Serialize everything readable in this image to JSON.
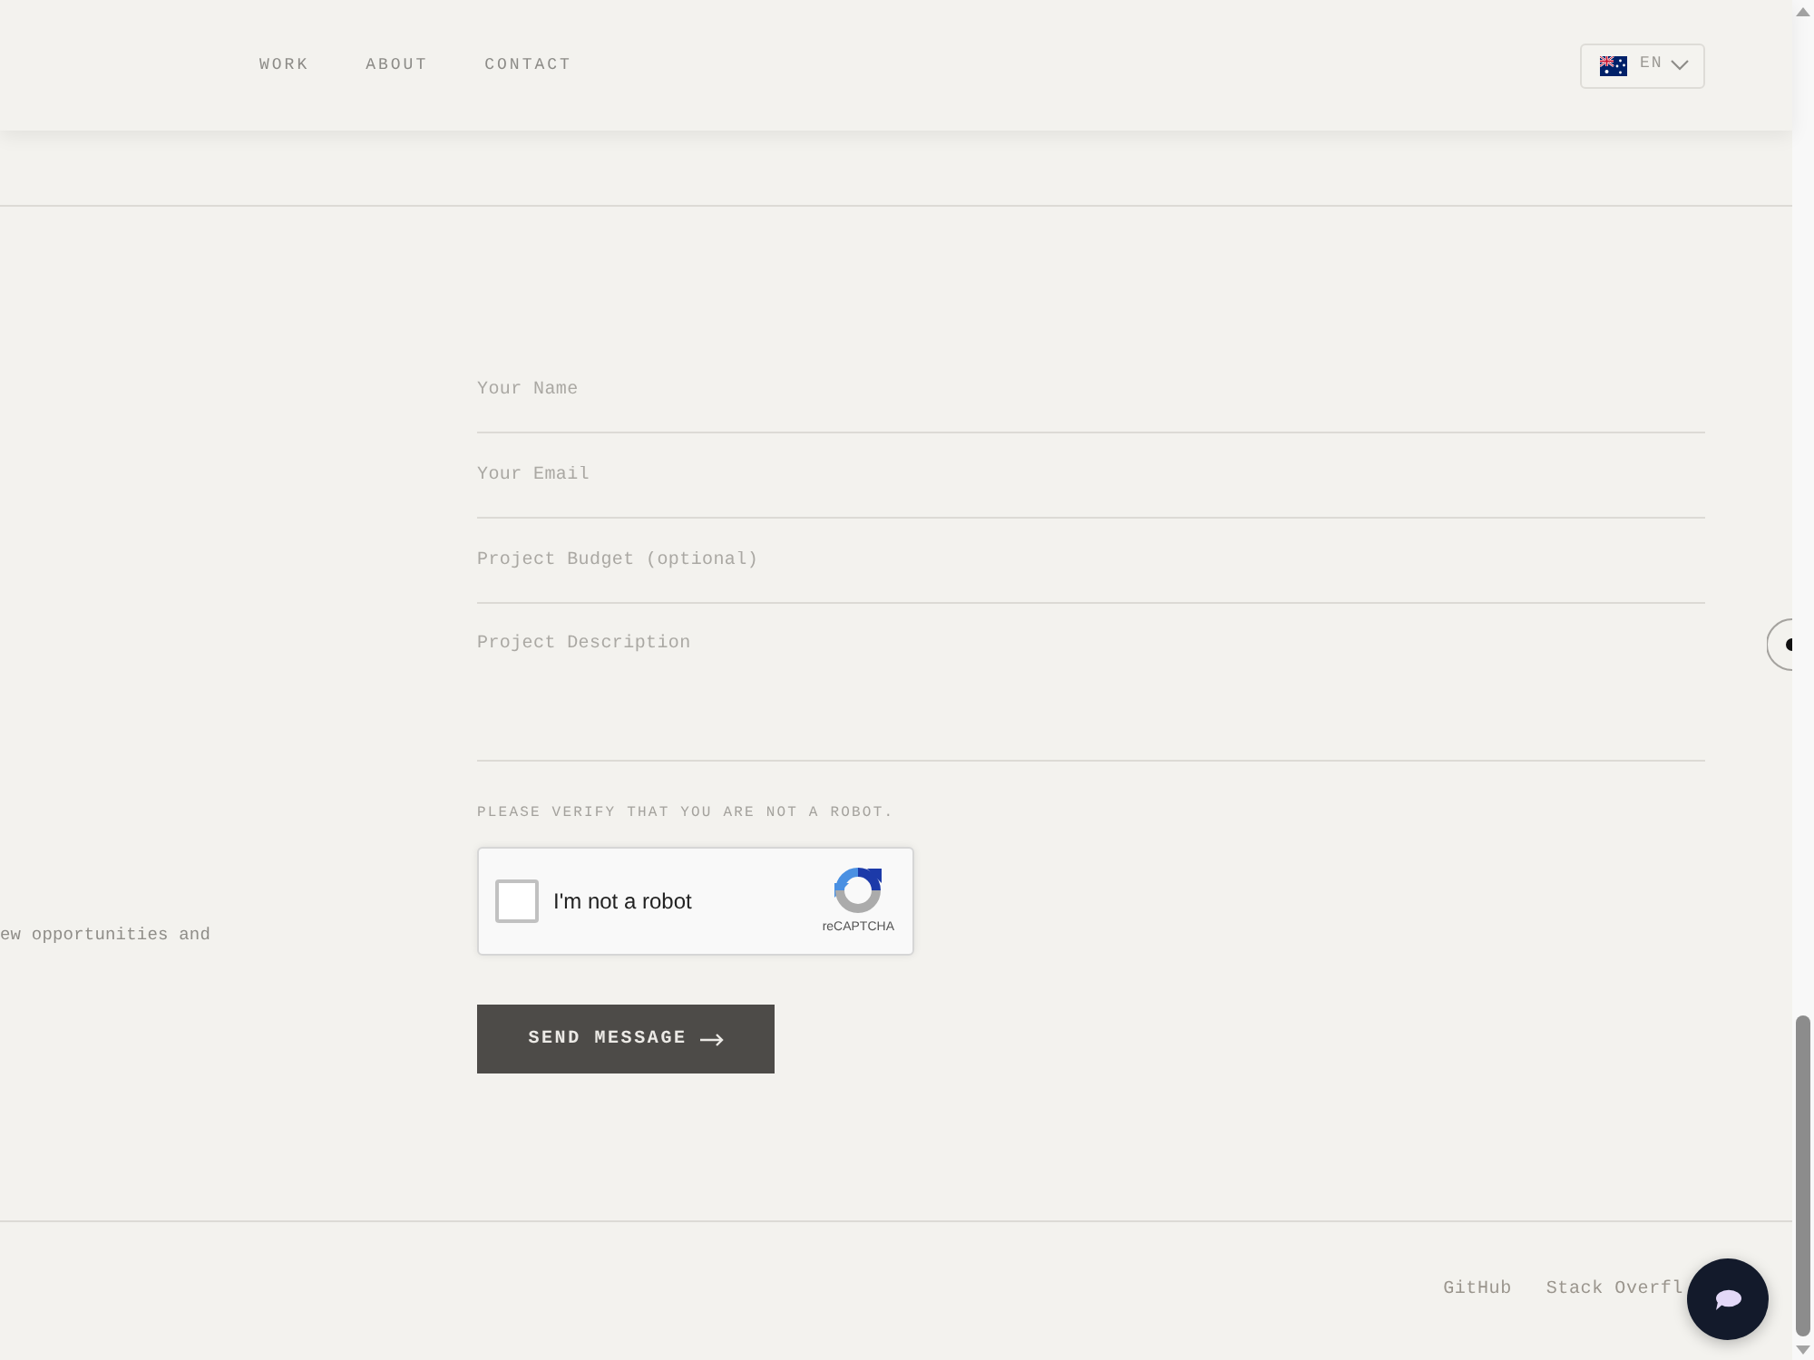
{
  "nav": {
    "links": [
      {
        "label": "WORK"
      },
      {
        "label": "ABOUT"
      },
      {
        "label": "CONTACT"
      }
    ],
    "language": {
      "label": "EN"
    }
  },
  "intro": {
    "text": "ew opportunities and"
  },
  "form": {
    "fields": [
      {
        "kind": "input",
        "placeholder": "Your Name"
      },
      {
        "kind": "input",
        "placeholder": "Your Email"
      },
      {
        "kind": "input",
        "placeholder": "Project Budget (optional)"
      },
      {
        "kind": "textarea",
        "placeholder": "Project Description"
      }
    ],
    "captcha": {
      "prompt": "PLEASE VERIFY THAT YOU ARE NOT A ROBOT.",
      "checkbox_label": "I'm not a robot",
      "checked": false,
      "brand": "reCAPTCHA"
    },
    "submit": {
      "label": "SEND MESSAGE"
    }
  },
  "footer": {
    "links": [
      {
        "label": "GitHub"
      },
      {
        "label": "Stack Overfl"
      }
    ]
  }
}
